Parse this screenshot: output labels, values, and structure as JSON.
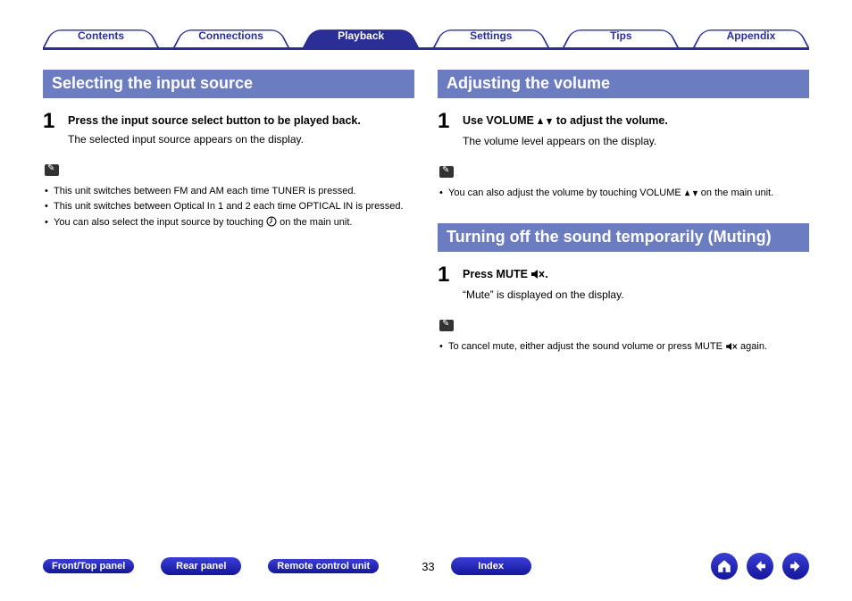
{
  "tabs": {
    "contents": "Contents",
    "connections": "Connections",
    "playback": "Playback",
    "settings": "Settings",
    "tips": "Tips",
    "appendix": "Appendix"
  },
  "left": {
    "heading": "Selecting the input source",
    "step1_bold": "Press the input source select button to be played back.",
    "step1_text": "The selected input source appears on the display.",
    "note1": "This unit switches between FM and AM each time TUNER is pressed.",
    "note2": "This unit switches between Optical In 1 and 2 each time OPTICAL IN is pressed.",
    "note3a": "You can also select the input source by touching ",
    "note3b": " on the main unit."
  },
  "right": {
    "heading1": "Adjusting the volume",
    "vol_step_bold_a": "Use VOLUME ",
    "vol_step_bold_b": " to adjust the volume.",
    "vol_step_text": "The volume level appears on the display.",
    "vol_note_a": "You can also adjust the volume by touching VOLUME ",
    "vol_note_b": " on the main unit.",
    "heading2": "Turning off the sound temporarily (Muting)",
    "mute_step_bold_a": "Press MUTE ",
    "mute_step_bold_b": ".",
    "mute_step_text": "“Mute” is displayed on the display.",
    "mute_note_a": "To cancel mute, either adjust the sound volume or press MUTE ",
    "mute_note_b": " again."
  },
  "footer": {
    "fronttop": "Front/Top panel",
    "rear": "Rear panel",
    "remote": "Remote control unit",
    "index": "Index",
    "page": "33"
  }
}
